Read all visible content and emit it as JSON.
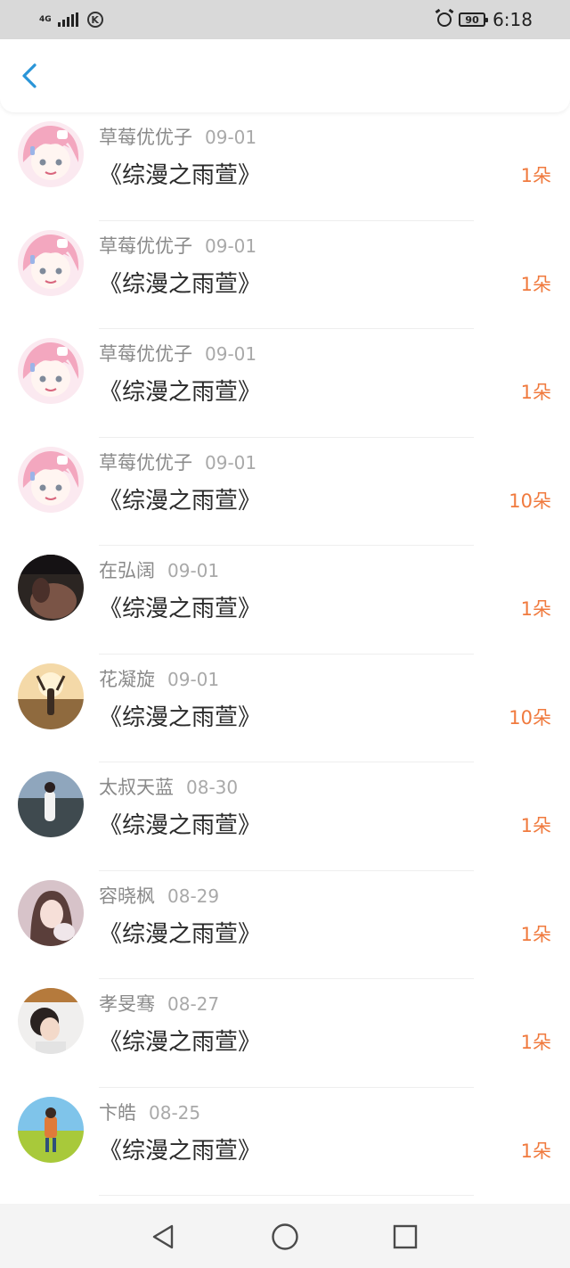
{
  "status_bar": {
    "network_type": "4G",
    "carrier_badge": "K",
    "battery_level": "90",
    "time": "6:18",
    "icons": [
      "signal-icon",
      "k-icon",
      "alarm-icon",
      "battery-icon"
    ]
  },
  "header": {
    "back_icon": "chevron-left-icon",
    "accent_color": "#2a95d8"
  },
  "items": [
    {
      "user": "草莓优优子",
      "date": "09-01",
      "title": "《综漫之雨萱》",
      "count": "1朵",
      "avatar": "anime-pink-hair"
    },
    {
      "user": "草莓优优子",
      "date": "09-01",
      "title": "《综漫之雨萱》",
      "count": "1朵",
      "avatar": "anime-pink-hair"
    },
    {
      "user": "草莓优优子",
      "date": "09-01",
      "title": "《综漫之雨萱》",
      "count": "1朵",
      "avatar": "anime-pink-hair"
    },
    {
      "user": "草莓优优子",
      "date": "09-01",
      "title": "《综漫之雨萱》",
      "count": "10朵",
      "avatar": "anime-pink-hair"
    },
    {
      "user": "在弘阔",
      "date": "09-01",
      "title": "《综漫之雨萱》",
      "count": "1朵",
      "avatar": "dark-photo"
    },
    {
      "user": "花凝旋",
      "date": "09-01",
      "title": "《综漫之雨萱》",
      "count": "10朵",
      "avatar": "sunset-photo"
    },
    {
      "user": "太叔天蓝",
      "date": "08-30",
      "title": "《综漫之雨萱》",
      "count": "1朵",
      "avatar": "seaside-photo"
    },
    {
      "user": "容晓枫",
      "date": "08-29",
      "title": "《综漫之雨萱》",
      "count": "1朵",
      "avatar": "girl-photo"
    },
    {
      "user": "孝旻骞",
      "date": "08-27",
      "title": "《综漫之雨萱》",
      "count": "1朵",
      "avatar": "child-photo"
    },
    {
      "user": "卞皓",
      "date": "08-25",
      "title": "《综漫之雨萱》",
      "count": "1朵",
      "avatar": "field-photo"
    }
  ],
  "colors": {
    "count": "#f07a3e",
    "name": "#8a8a8a",
    "date": "#a9a9a9",
    "title": "#2a2a2a",
    "status_bar_bg": "#d9d9d9"
  },
  "nav_bar": {
    "buttons": [
      "back-triangle-icon",
      "home-circle-icon",
      "recents-square-icon"
    ]
  }
}
